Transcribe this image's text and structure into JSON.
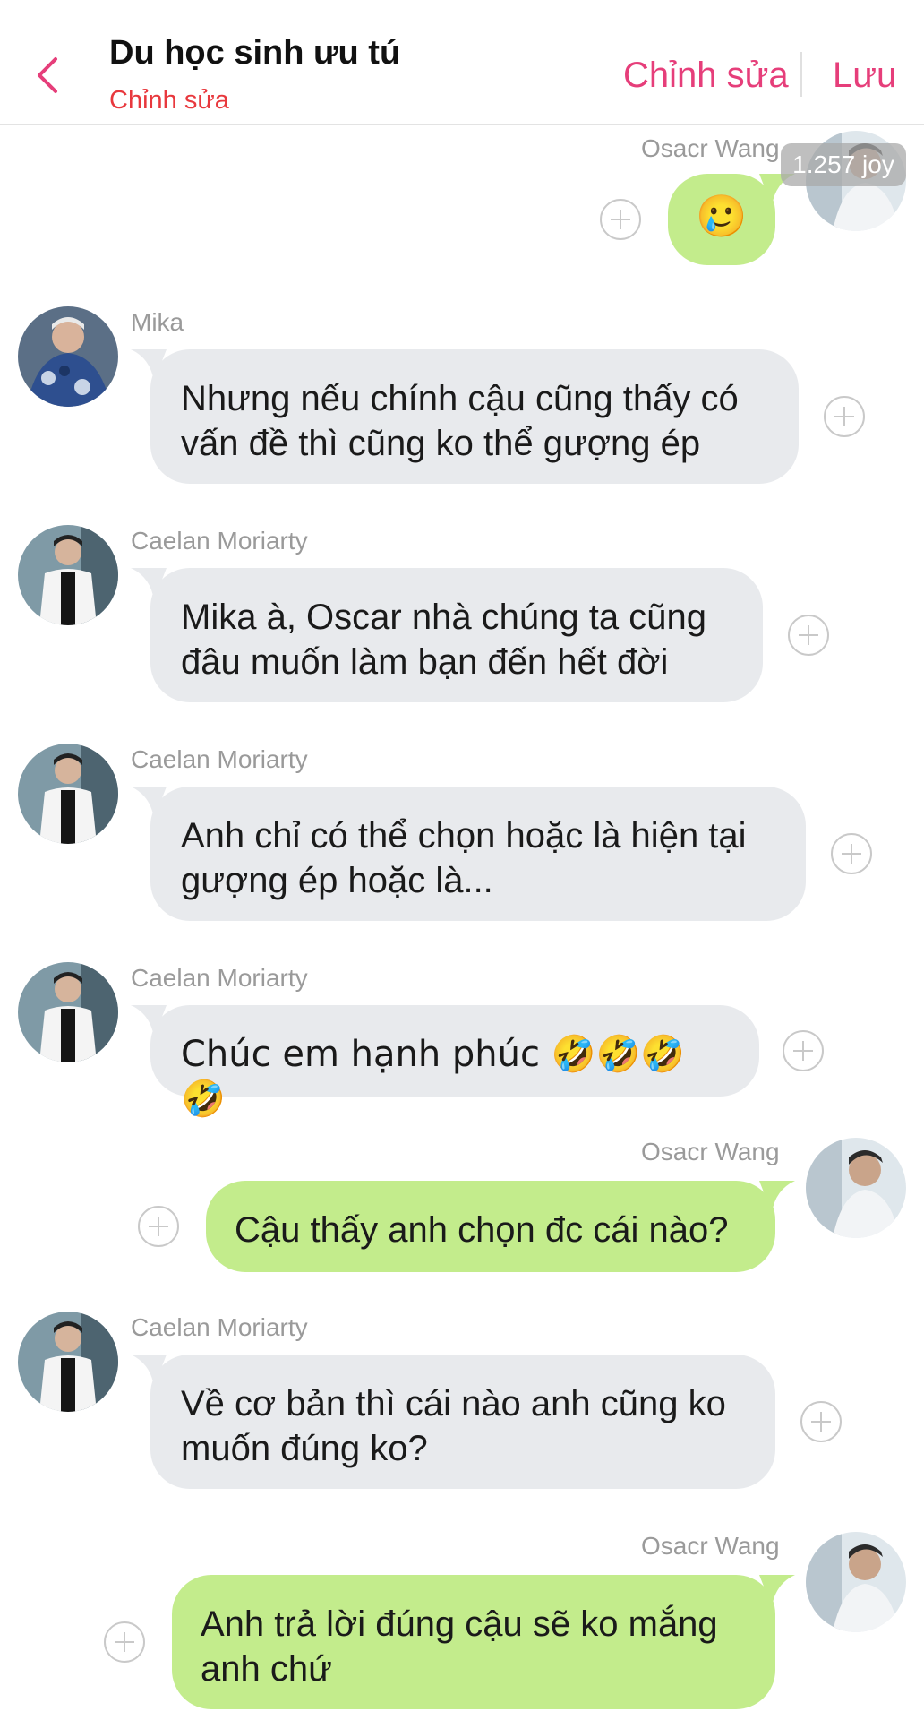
{
  "header": {
    "title": "Du học sinh ưu tú",
    "subtitle": "Chỉnh sửa",
    "edit_label": "Chỉnh sửa",
    "save_label": "Lưu"
  },
  "colors": {
    "accent": "#e63e7a",
    "subtitle": "#e8383d",
    "incoming_bubble": "#e8eaed",
    "outgoing_bubble": "#c3ec8c"
  },
  "first_message": {
    "sender": "Osacr Wang",
    "emoji": "🥲",
    "joy_badge": "1.257 joy"
  },
  "messages": [
    {
      "sender": "Mika",
      "text": "Nhưng nếu chính cậu cũng thấy có vấn đề thì cũng ko thể gượng ép"
    },
    {
      "sender": "Caelan Moriarty",
      "text": "Mika à, Oscar nhà chúng ta cũng đâu muốn làm bạn đến hết đời"
    },
    {
      "sender": "Caelan Moriarty",
      "text": "Anh chỉ có thể chọn hoặc là hiện tại gượng ép hoặc là..."
    },
    {
      "sender": "Caelan Moriarty",
      "text": "Chúc em hạnh phúc 🤣🤣🤣🤣"
    },
    {
      "sender": "Osacr Wang",
      "text": "Cậu thấy anh chọn đc cái nào?"
    },
    {
      "sender": "Caelan Moriarty",
      "text": "Về cơ bản thì cái nào anh cũng ko muốn đúng ko?"
    },
    {
      "sender": "Osacr Wang",
      "text": "Anh trả lời đúng cậu sẽ ko mắng anh chứ"
    }
  ]
}
